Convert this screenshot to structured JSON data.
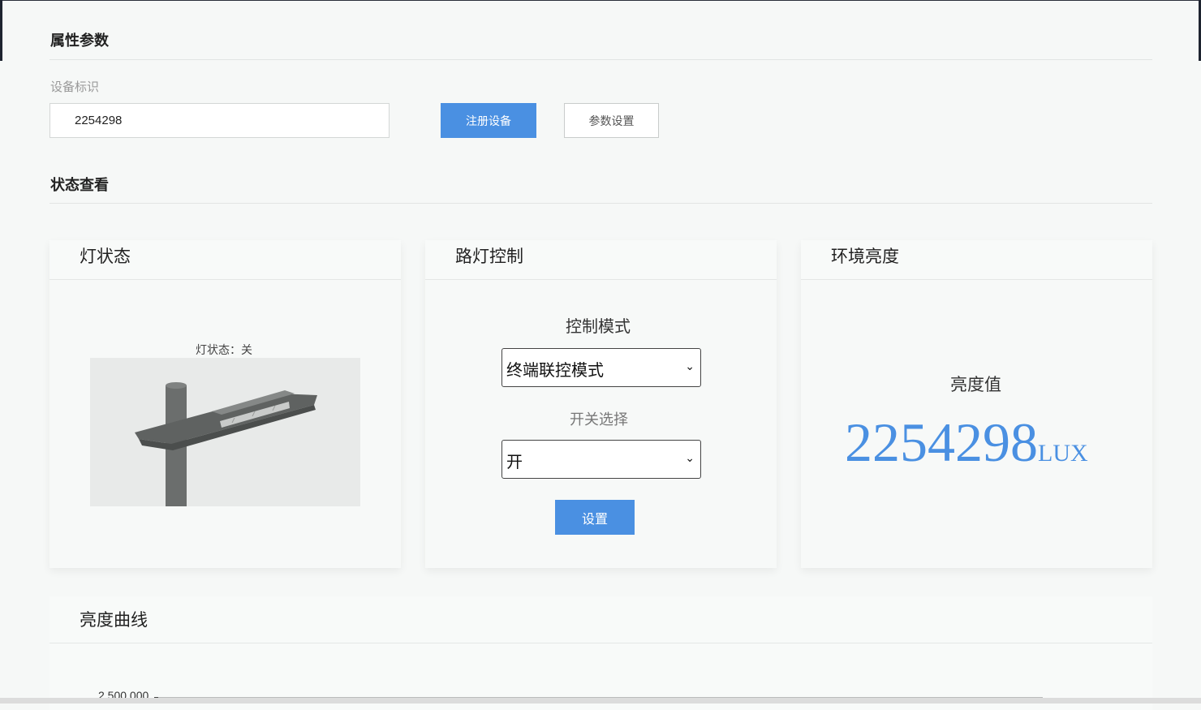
{
  "attributes": {
    "section_title": "属性参数",
    "device_id_label": "设备标识",
    "device_id_value": "2254298",
    "register_button": "注册设备",
    "params_button": "参数设置"
  },
  "status": {
    "section_title": "状态查看",
    "lamp_card": {
      "title": "灯状态",
      "caption": "灯状态：关"
    },
    "control_card": {
      "title": "路灯控制",
      "mode_label": "控制模式",
      "mode_selected": "终端联控模式",
      "switch_label": "开关选择",
      "switch_selected": "开",
      "set_button": "设置"
    },
    "brightness_card": {
      "title": "环境亮度",
      "value_label": "亮度值",
      "value": "2254298",
      "unit": "LUX"
    }
  },
  "chart_data": {
    "type": "line",
    "title": "亮度曲线",
    "y_ticks": [
      "2,500,000"
    ],
    "series": []
  },
  "colors": {
    "accent": "#4a90e2",
    "background": "#f6f8f7"
  }
}
